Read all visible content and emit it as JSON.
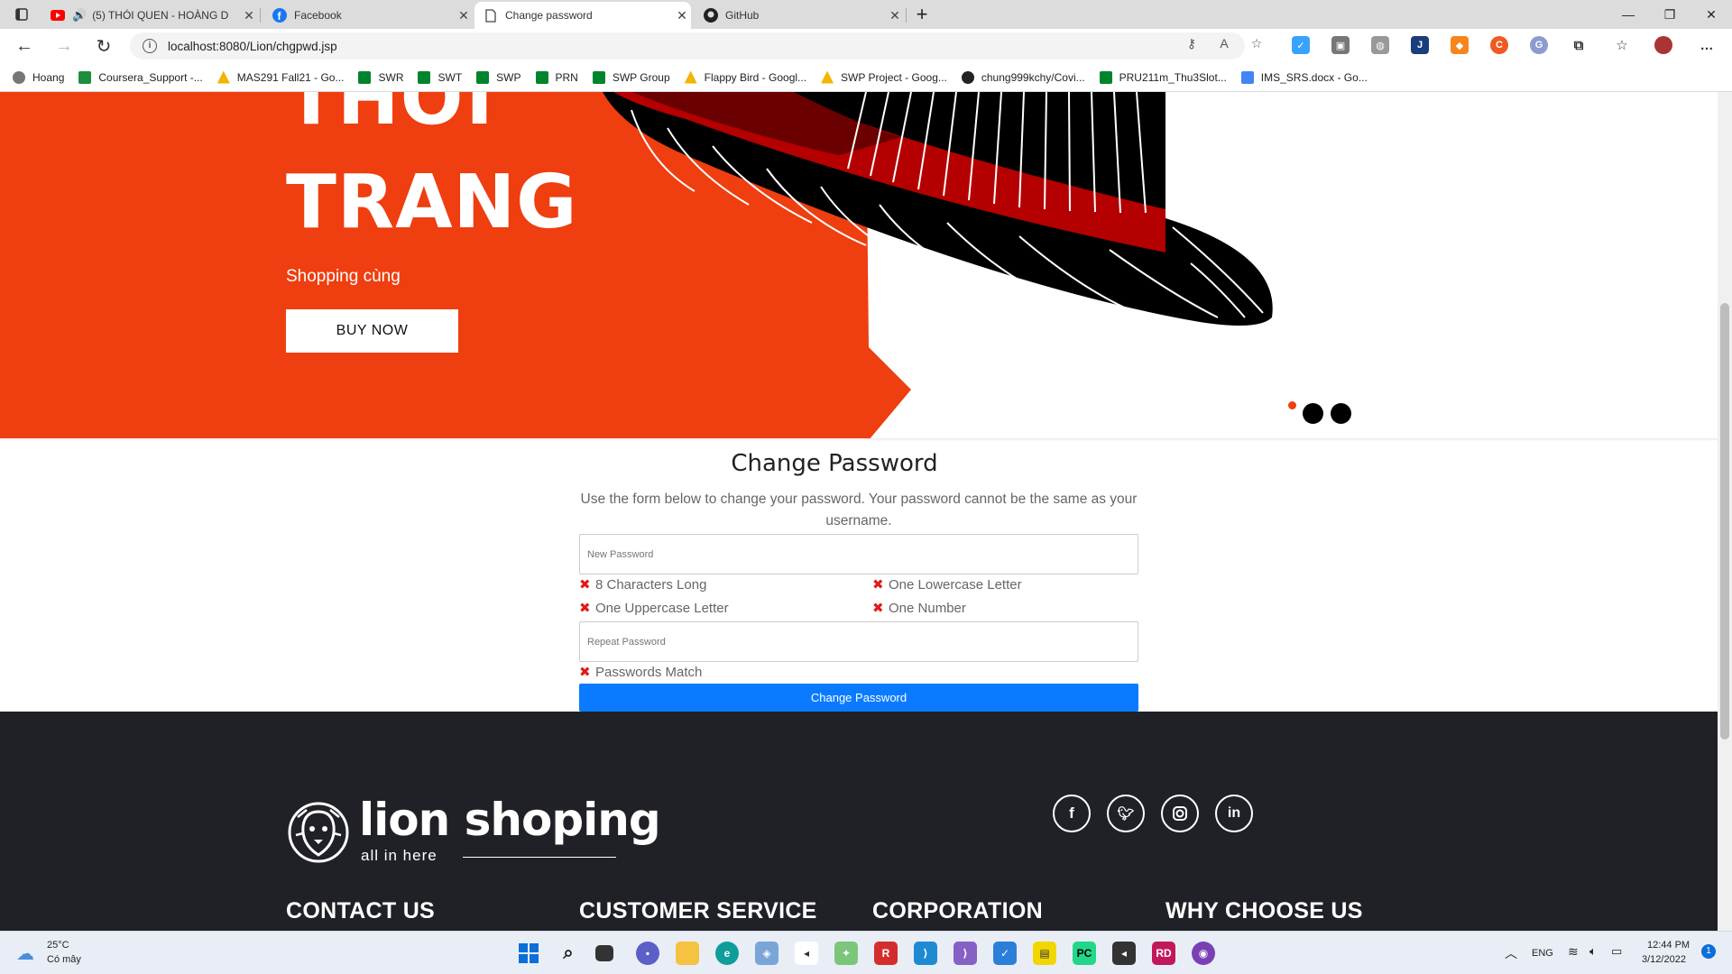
{
  "browser": {
    "tabs": [
      {
        "label": "(5) THÓI QUEN - HOÀNG D",
        "icon": "youtube-icon"
      },
      {
        "label": "Facebook",
        "icon": "facebook-icon"
      },
      {
        "label": "Change password",
        "icon": "page-icon"
      },
      {
        "label": "GitHub",
        "icon": "github-icon"
      }
    ],
    "url": "localhost:8080/Lion/chgpwd.jsp",
    "bookmarks": [
      {
        "label": "Hoang",
        "color": "#666666"
      },
      {
        "label": "Coursera_Support -...",
        "color": "#1e8e3e"
      },
      {
        "label": "MAS291 Fall21 - Go...",
        "color": "#f4b400"
      },
      {
        "label": "SWR",
        "color": "#00832d"
      },
      {
        "label": "SWT",
        "color": "#00832d"
      },
      {
        "label": "SWP",
        "color": "#00832d"
      },
      {
        "label": "PRN",
        "color": "#00832d"
      },
      {
        "label": "SWP Group",
        "color": "#00832d"
      },
      {
        "label": "Flappy Bird - Googl...",
        "color": "#f4b400"
      },
      {
        "label": "SWP Project - Goog...",
        "color": "#f4b400"
      },
      {
        "label": "chung999kchy/Covi...",
        "color": "#222222"
      },
      {
        "label": "PRU211m_Thu3Slot...",
        "color": "#00832d"
      },
      {
        "label": "IMS_SRS.docx - Go...",
        "color": "#4285f4"
      }
    ]
  },
  "hero": {
    "title_line1": "THỜI",
    "title_line2": "TRANG",
    "subtitle": "Shopping cùng",
    "button": "BUY NOW",
    "accent": "#ef3e0f"
  },
  "form": {
    "title": "Change Password",
    "description": "Use the form below to change your password. Your password cannot be the same as your username.",
    "new_password_placeholder": "New Password",
    "repeat_password_placeholder": "Repeat Password",
    "rules": [
      "8 Characters Long",
      "One Lowercase Letter",
      "One Uppercase Letter",
      "One Number"
    ],
    "match_rule": "Passwords Match",
    "submit": "Change Password",
    "submit_color": "#0a7bff"
  },
  "footer": {
    "brand": "lion shoping",
    "tagline": "all in here",
    "socials": [
      "facebook-icon",
      "twitter-icon",
      "instagram-icon",
      "linkedin-icon"
    ],
    "headings": [
      "CONTACT US",
      "CUSTOMER SERVICE",
      "CORPORATION",
      "WHY CHOOSE US"
    ]
  },
  "taskbar": {
    "weather_temp": "25°C",
    "weather_desc": "Có mây",
    "lang": "ENG",
    "time": "12:44 PM",
    "date": "3/12/2022",
    "notifications": "1"
  }
}
